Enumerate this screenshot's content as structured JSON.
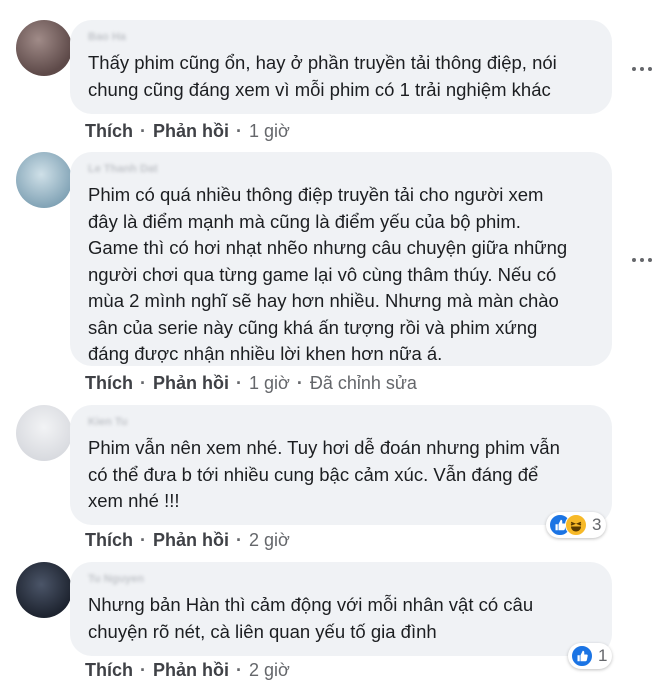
{
  "comments": [
    {
      "author": "Bao Ha",
      "text": "Thấy phim cũng ổn, hay ở phần truyền tải thông điệp, nói\nchung cũng đáng xem vì mỗi phim có 1 trải nghiệm khác",
      "like_label": "Thích",
      "reply_label": "Phản hồi",
      "time": "1 giờ"
    },
    {
      "author": "Le Thanh Dat",
      "text": "Phim có quá nhiều thông điệp truyền tải cho người xem\nđây là điểm mạnh mà cũng là điểm yếu của bộ phim.\nGame thì có hơi nhạt nhẽo nhưng câu chuyện giữa những\nngười chơi qua từng game lại vô cùng thâm thúy. Nếu có\nmùa 2 mình nghĩ sẽ hay hơn nhiều. Nhưng mà màn chào\nsân của serie này cũng khá ấn tượng rồi và phim xứng\nđáng được nhận nhiều lời khen hơn nữa á.",
      "like_label": "Thích",
      "reply_label": "Phản hồi",
      "time": "1 giờ",
      "edited": "Đã chỉnh sửa"
    },
    {
      "author": "Kien Tu",
      "text": "Phim vẫn nên xem nhé. Tuy hơi dễ đoán nhưng phim vẫn\ncó thể đưa b tới nhiều cung bậc cảm xúc. Vẫn đáng để\nxem nhé !!!",
      "like_label": "Thích",
      "reply_label": "Phản hồi",
      "time": "2 giờ",
      "reaction_count": "3"
    },
    {
      "author": "Tu Nguyen",
      "text": "Nhưng bản Hàn thì cảm động với mỗi nhân vật có câu\nchuyện rõ nét, cà liên quan yếu tố gia đình",
      "like_label": "Thích",
      "reply_label": "Phản hồi",
      "time": "2 giờ",
      "reaction_count": "1"
    }
  ],
  "icons": {
    "like": "like-icon",
    "haha": "haha-icon",
    "more": "more-options-icon"
  },
  "colors": {
    "bubble": "#f0f2f5",
    "like_blue": "#1b74e4",
    "haha_yellow": "#f7b928",
    "secondary_text": "#65676b"
  }
}
